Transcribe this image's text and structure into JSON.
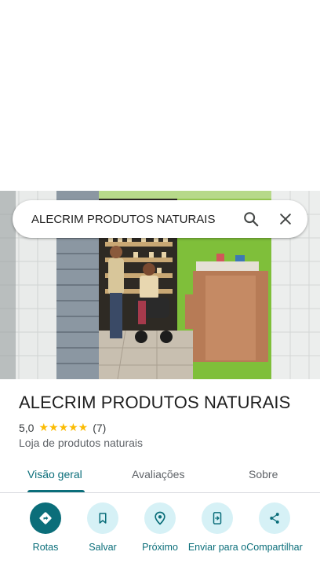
{
  "search": {
    "query": "ALECRIM PRODUTOS NATURAIS"
  },
  "place": {
    "name": "ALECRIM PRODUTOS NATURAIS",
    "rating": "5,0",
    "stars": "★★★★★",
    "reviews_count": "(7)",
    "category": "Loja de produtos naturais"
  },
  "tabs": [
    {
      "label": "Visão geral",
      "active": true
    },
    {
      "label": "Avaliações",
      "active": false
    },
    {
      "label": "Sobre",
      "active": false
    }
  ],
  "actions": [
    {
      "label": "Rotas",
      "icon": "directions-icon"
    },
    {
      "label": "Salvar",
      "icon": "bookmark-icon"
    },
    {
      "label": "Próximo",
      "icon": "nearby-icon"
    },
    {
      "label": "Enviar para o",
      "icon": "send-to-phone-icon"
    },
    {
      "label": "Compartilhar",
      "icon": "share-icon"
    }
  ],
  "colors": {
    "accent": "#0b6e7a",
    "action_bg": "#d6f1f6",
    "star": "#fbbc04"
  }
}
